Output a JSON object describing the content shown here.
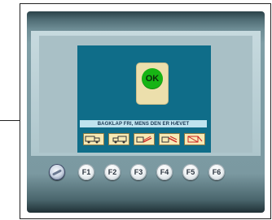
{
  "screen": {
    "ok_label": "OK",
    "message": "BAGKLAP FRI, MENS DEN ER HÆVET",
    "icons": [
      {
        "name": "truck-left-icon"
      },
      {
        "name": "truck-right-icon"
      },
      {
        "name": "tailgate-ramp-icon"
      },
      {
        "name": "tailgate-tilt-icon"
      },
      {
        "name": "tailgate-fold-icon"
      }
    ]
  },
  "keypad": {
    "power_icon": "power-icon",
    "function_keys": [
      "F1",
      "F2",
      "F3",
      "F4",
      "F5",
      "F6"
    ]
  },
  "colors": {
    "screen_bg": "#0f6d89",
    "ok_green": "#17b414",
    "message_bar": "#bfe3ef",
    "icon_bg": "#f7e9b4",
    "icon_red": "#cc2222"
  }
}
